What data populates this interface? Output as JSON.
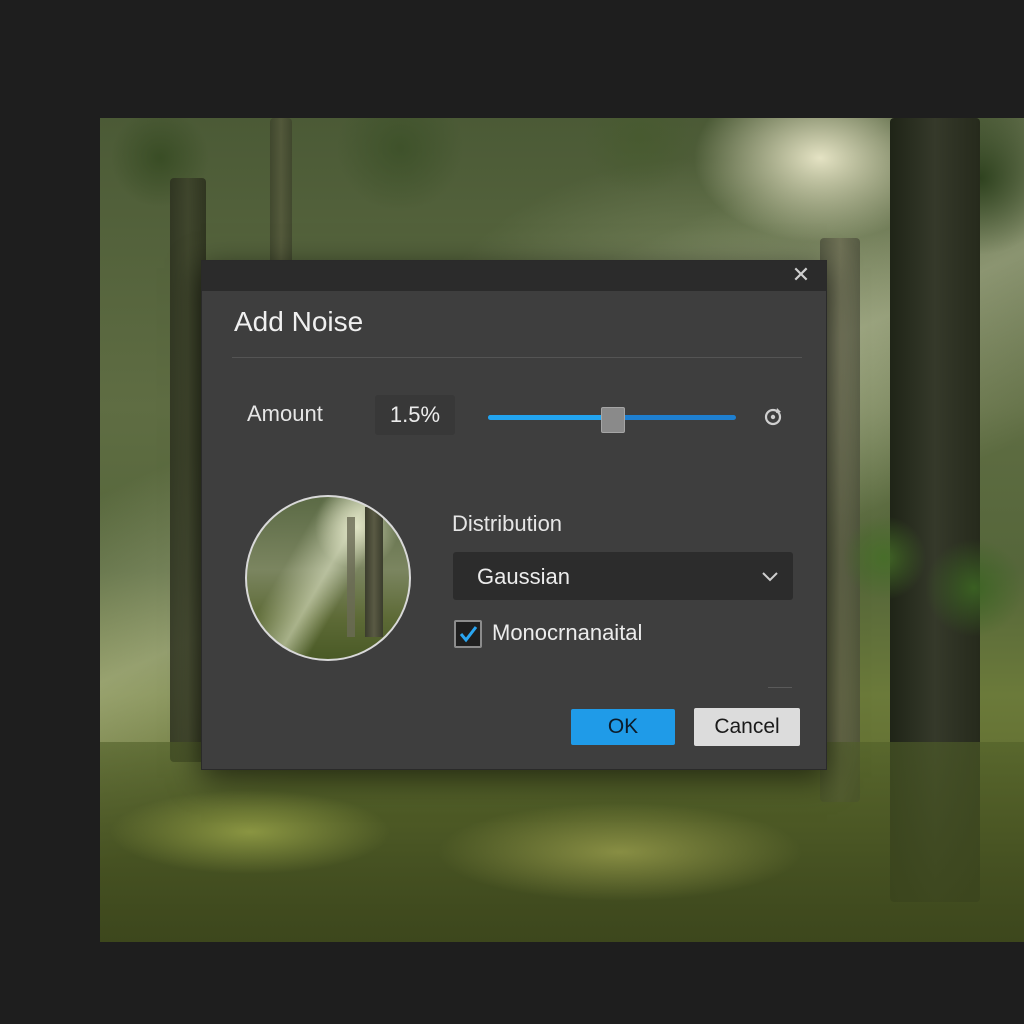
{
  "dialog": {
    "title": "Add Noise",
    "close_icon": "close-icon",
    "amount": {
      "label": "Amount",
      "value": "1.5%",
      "slider_fraction": 0.5
    },
    "reset_icon": "reset-icon",
    "distribution": {
      "label": "Distribution",
      "selected": "Gaussian",
      "icon": "chevron-down-icon"
    },
    "monochromatic": {
      "label": "Monocrnanaital",
      "checked": true
    },
    "buttons": {
      "ok": "OK",
      "cancel": "Cancel"
    }
  },
  "colors": {
    "accent": "#1f9be8",
    "dialog_bg": "#3e3e3e",
    "titlebar_bg": "#2b2b2b"
  }
}
